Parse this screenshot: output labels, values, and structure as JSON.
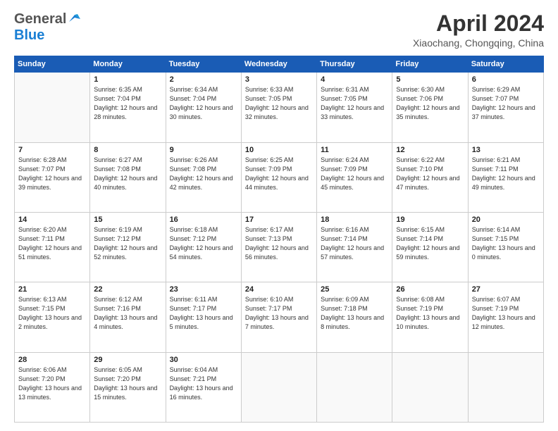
{
  "header": {
    "logo_line1": "General",
    "logo_line2": "Blue",
    "title": "April 2024",
    "subtitle": "Xiaochang, Chongqing, China"
  },
  "calendar": {
    "days_of_week": [
      "Sunday",
      "Monday",
      "Tuesday",
      "Wednesday",
      "Thursday",
      "Friday",
      "Saturday"
    ],
    "weeks": [
      [
        {
          "day": "",
          "info": ""
        },
        {
          "day": "1",
          "info": "Sunrise: 6:35 AM\nSunset: 7:04 PM\nDaylight: 12 hours\nand 28 minutes."
        },
        {
          "day": "2",
          "info": "Sunrise: 6:34 AM\nSunset: 7:04 PM\nDaylight: 12 hours\nand 30 minutes."
        },
        {
          "day": "3",
          "info": "Sunrise: 6:33 AM\nSunset: 7:05 PM\nDaylight: 12 hours\nand 32 minutes."
        },
        {
          "day": "4",
          "info": "Sunrise: 6:31 AM\nSunset: 7:05 PM\nDaylight: 12 hours\nand 33 minutes."
        },
        {
          "day": "5",
          "info": "Sunrise: 6:30 AM\nSunset: 7:06 PM\nDaylight: 12 hours\nand 35 minutes."
        },
        {
          "day": "6",
          "info": "Sunrise: 6:29 AM\nSunset: 7:07 PM\nDaylight: 12 hours\nand 37 minutes."
        }
      ],
      [
        {
          "day": "7",
          "info": "Sunrise: 6:28 AM\nSunset: 7:07 PM\nDaylight: 12 hours\nand 39 minutes."
        },
        {
          "day": "8",
          "info": "Sunrise: 6:27 AM\nSunset: 7:08 PM\nDaylight: 12 hours\nand 40 minutes."
        },
        {
          "day": "9",
          "info": "Sunrise: 6:26 AM\nSunset: 7:08 PM\nDaylight: 12 hours\nand 42 minutes."
        },
        {
          "day": "10",
          "info": "Sunrise: 6:25 AM\nSunset: 7:09 PM\nDaylight: 12 hours\nand 44 minutes."
        },
        {
          "day": "11",
          "info": "Sunrise: 6:24 AM\nSunset: 7:09 PM\nDaylight: 12 hours\nand 45 minutes."
        },
        {
          "day": "12",
          "info": "Sunrise: 6:22 AM\nSunset: 7:10 PM\nDaylight: 12 hours\nand 47 minutes."
        },
        {
          "day": "13",
          "info": "Sunrise: 6:21 AM\nSunset: 7:11 PM\nDaylight: 12 hours\nand 49 minutes."
        }
      ],
      [
        {
          "day": "14",
          "info": "Sunrise: 6:20 AM\nSunset: 7:11 PM\nDaylight: 12 hours\nand 51 minutes."
        },
        {
          "day": "15",
          "info": "Sunrise: 6:19 AM\nSunset: 7:12 PM\nDaylight: 12 hours\nand 52 minutes."
        },
        {
          "day": "16",
          "info": "Sunrise: 6:18 AM\nSunset: 7:12 PM\nDaylight: 12 hours\nand 54 minutes."
        },
        {
          "day": "17",
          "info": "Sunrise: 6:17 AM\nSunset: 7:13 PM\nDaylight: 12 hours\nand 56 minutes."
        },
        {
          "day": "18",
          "info": "Sunrise: 6:16 AM\nSunset: 7:14 PM\nDaylight: 12 hours\nand 57 minutes."
        },
        {
          "day": "19",
          "info": "Sunrise: 6:15 AM\nSunset: 7:14 PM\nDaylight: 12 hours\nand 59 minutes."
        },
        {
          "day": "20",
          "info": "Sunrise: 6:14 AM\nSunset: 7:15 PM\nDaylight: 13 hours\nand 0 minutes."
        }
      ],
      [
        {
          "day": "21",
          "info": "Sunrise: 6:13 AM\nSunset: 7:15 PM\nDaylight: 13 hours\nand 2 minutes."
        },
        {
          "day": "22",
          "info": "Sunrise: 6:12 AM\nSunset: 7:16 PM\nDaylight: 13 hours\nand 4 minutes."
        },
        {
          "day": "23",
          "info": "Sunrise: 6:11 AM\nSunset: 7:17 PM\nDaylight: 13 hours\nand 5 minutes."
        },
        {
          "day": "24",
          "info": "Sunrise: 6:10 AM\nSunset: 7:17 PM\nDaylight: 13 hours\nand 7 minutes."
        },
        {
          "day": "25",
          "info": "Sunrise: 6:09 AM\nSunset: 7:18 PM\nDaylight: 13 hours\nand 8 minutes."
        },
        {
          "day": "26",
          "info": "Sunrise: 6:08 AM\nSunset: 7:19 PM\nDaylight: 13 hours\nand 10 minutes."
        },
        {
          "day": "27",
          "info": "Sunrise: 6:07 AM\nSunset: 7:19 PM\nDaylight: 13 hours\nand 12 minutes."
        }
      ],
      [
        {
          "day": "28",
          "info": "Sunrise: 6:06 AM\nSunset: 7:20 PM\nDaylight: 13 hours\nand 13 minutes."
        },
        {
          "day": "29",
          "info": "Sunrise: 6:05 AM\nSunset: 7:20 PM\nDaylight: 13 hours\nand 15 minutes."
        },
        {
          "day": "30",
          "info": "Sunrise: 6:04 AM\nSunset: 7:21 PM\nDaylight: 13 hours\nand 16 minutes."
        },
        {
          "day": "",
          "info": ""
        },
        {
          "day": "",
          "info": ""
        },
        {
          "day": "",
          "info": ""
        },
        {
          "day": "",
          "info": ""
        }
      ]
    ]
  }
}
